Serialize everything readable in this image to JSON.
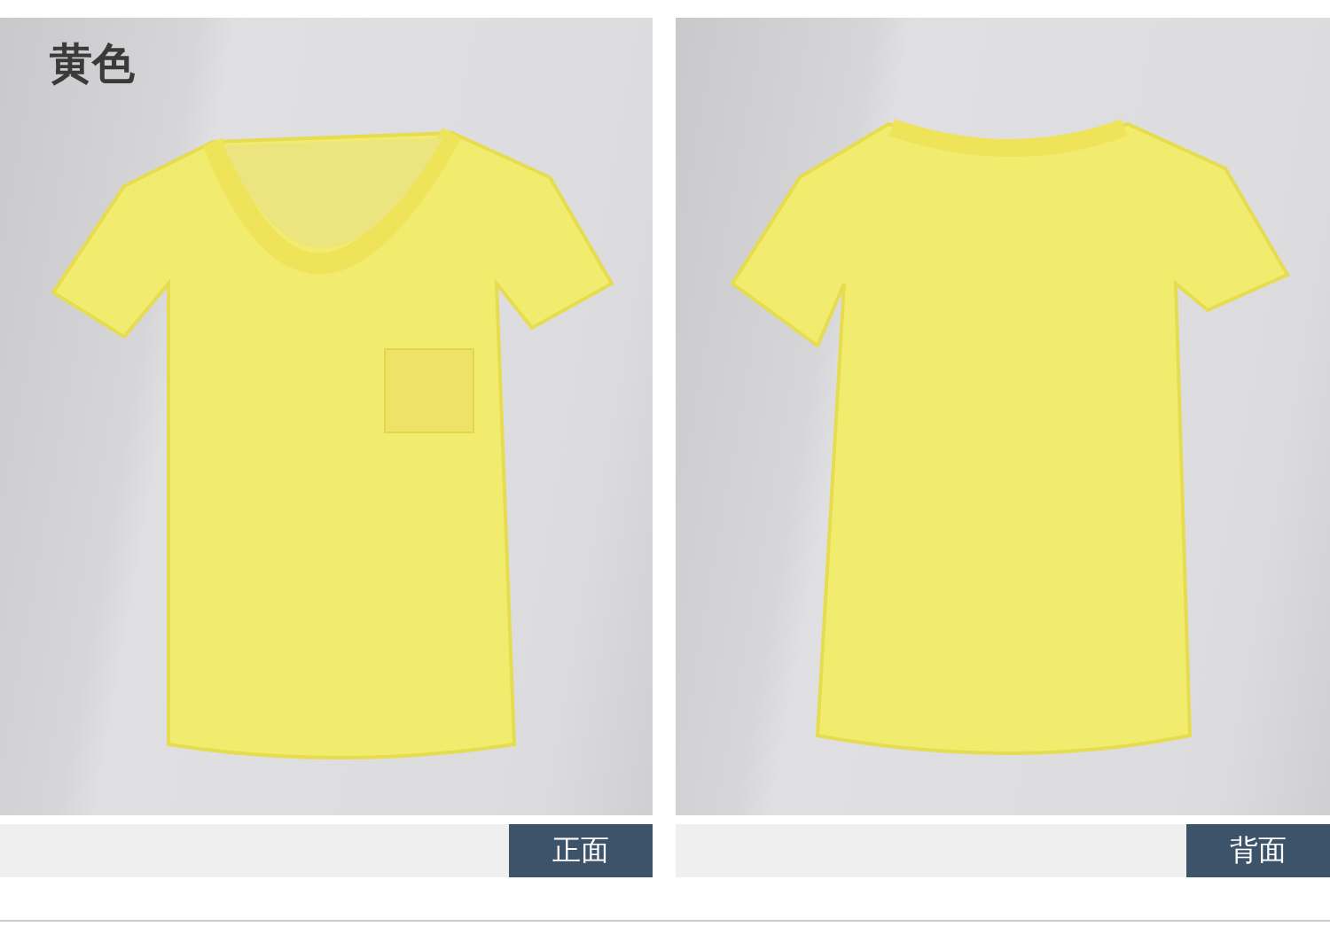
{
  "color_label": "黄色",
  "views": [
    {
      "kind": "front",
      "caption": "正面"
    },
    {
      "kind": "back",
      "caption": "背面"
    }
  ]
}
